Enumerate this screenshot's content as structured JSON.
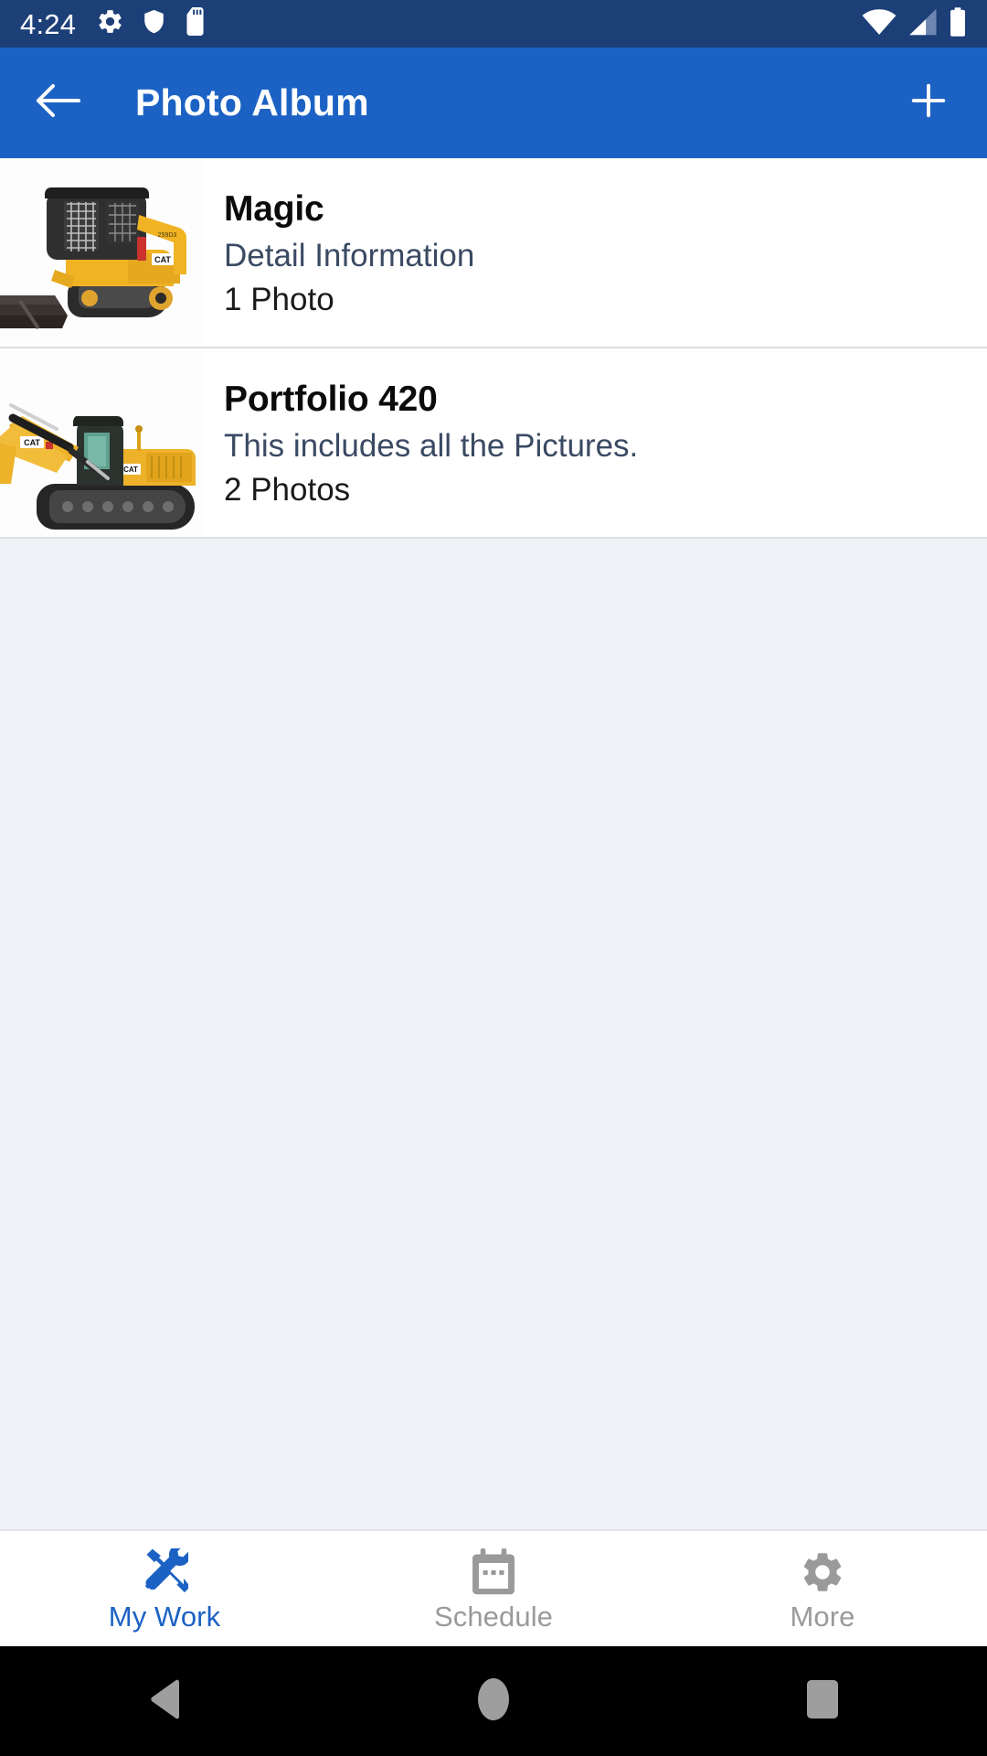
{
  "status_bar": {
    "time": "4:24",
    "left_icons": [
      "gear-icon",
      "shield-icon",
      "sd-card-icon"
    ],
    "right_icons": [
      "wifi-icon",
      "cellular-signal-icon",
      "battery-icon"
    ],
    "background_color": "#1D3F78",
    "foreground_color": "#FFFFFF"
  },
  "app_bar": {
    "title": "Photo Album",
    "back_icon": "arrow-left-icon",
    "add_icon": "plus-icon",
    "background_color": "#1C62C4",
    "foreground_color": "#FFFFFF"
  },
  "albums": [
    {
      "title": "Magic",
      "description": "Detail Information",
      "photo_count": "1 Photo",
      "thumbnail": "cat-compact-track-loader-photo"
    },
    {
      "title": "Portfolio 420",
      "description": "This includes all the Pictures.",
      "photo_count": "2 Photos",
      "thumbnail": "cat-excavator-photo"
    }
  ],
  "bottom_nav": {
    "active_color": "#1C62C4",
    "inactive_color": "#9A9A9A",
    "items": [
      {
        "label": "My Work",
        "icon": "tools-icon",
        "active": true
      },
      {
        "label": "Schedule",
        "icon": "calendar-icon",
        "active": false
      },
      {
        "label": "More",
        "icon": "gear-icon",
        "active": false
      }
    ]
  },
  "system_nav": {
    "items": [
      {
        "icon": "android-back-icon"
      },
      {
        "icon": "android-home-icon"
      },
      {
        "icon": "android-recents-icon"
      }
    ],
    "background_color": "#000000",
    "foreground_color": "#9E9E9E"
  }
}
